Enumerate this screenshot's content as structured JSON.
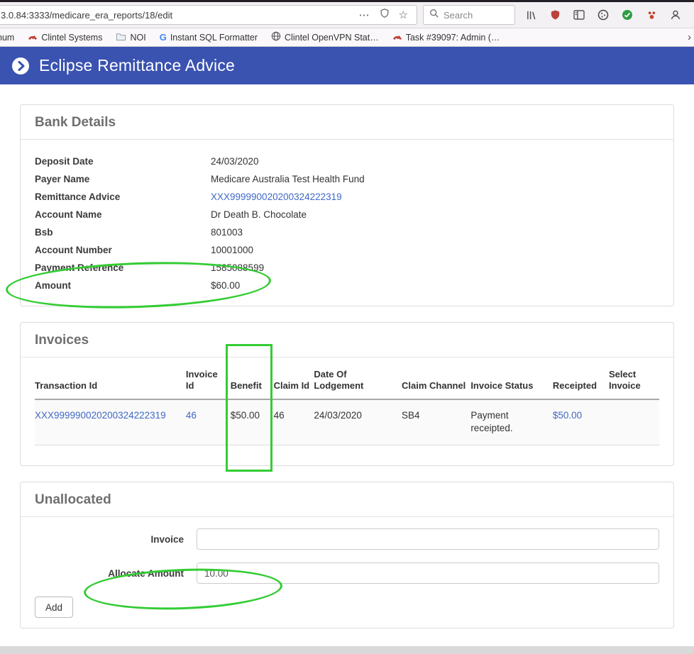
{
  "colors": {
    "header_bg": "#3a52b0",
    "link_blue": "#3f68c5",
    "annotation_green": "#33cc33"
  },
  "browser": {
    "url": "3.0.84:3333/medicare_era_reports/18/edit",
    "page_actions": "⋯",
    "bookmark_star": "☆",
    "search_placeholder": "Search",
    "overflow_chevron": "›",
    "bookmarks": [
      {
        "label": "num"
      },
      {
        "label": "Clintel Systems"
      },
      {
        "label": "NOI"
      },
      {
        "label": "Instant SQL Formatter"
      },
      {
        "label": "Clintel OpenVPN Stat…"
      },
      {
        "label": "Task #39097: Admin (…"
      }
    ]
  },
  "header": {
    "title": "Eclipse Remittance Advice"
  },
  "bank_details": {
    "title": "Bank Details",
    "fields": [
      {
        "label": "Deposit Date",
        "value": "24/03/2020"
      },
      {
        "label": "Payer Name",
        "value": "Medicare Australia Test Health Fund"
      },
      {
        "label": "Remittance Advice",
        "value": "XXX999990020200324222319"
      },
      {
        "label": "Account Name",
        "value": "Dr Death B. Chocolate"
      },
      {
        "label": "Bsb",
        "value": "801003"
      },
      {
        "label": "Account Number",
        "value": "10001000"
      },
      {
        "label": "Payment Reference",
        "value": "1585088599"
      },
      {
        "label": "Amount",
        "value": "$60.00"
      }
    ]
  },
  "invoices": {
    "title": "Invoices",
    "columns": [
      "Transaction Id",
      "Invoice Id",
      "Benefit",
      "Claim Id",
      "Date Of Lodgement",
      "Claim Channel",
      "Invoice Status",
      "Receipted",
      "Select Invoice"
    ],
    "rows": [
      {
        "transaction_id": "XXX999990020200324222319",
        "invoice_id": "46",
        "benefit": "$50.00",
        "claim_id": "46",
        "date_of_lodgement": "24/03/2020",
        "claim_channel": "SB4",
        "invoice_status": "Payment receipted.",
        "receipted": "$50.00",
        "select_invoice": ""
      }
    ]
  },
  "unallocated": {
    "title": "Unallocated",
    "invoice_label": "Invoice",
    "invoice_value": "",
    "allocate_amount_label": "Allocate Amount",
    "allocate_amount_value": "10.00",
    "add_button": "Add"
  }
}
